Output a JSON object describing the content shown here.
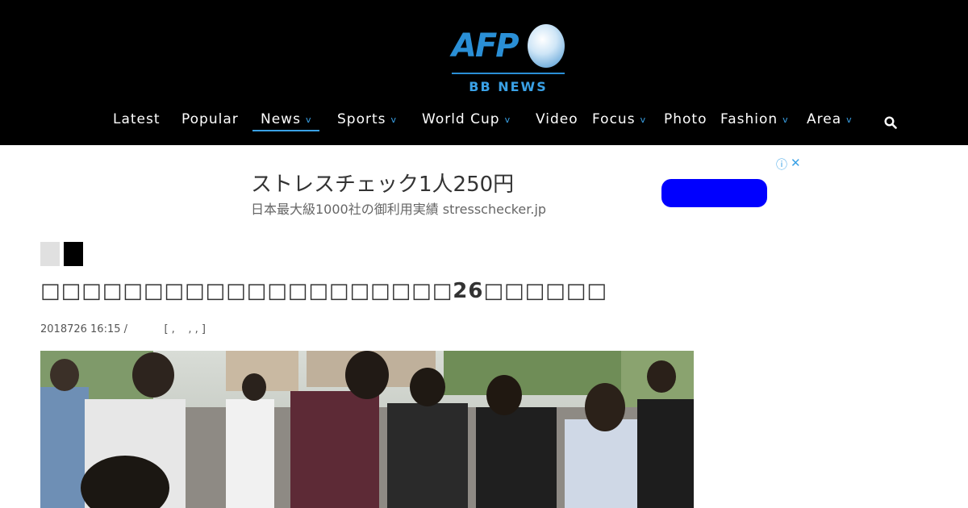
{
  "brand": {
    "logo_text": "AFP",
    "logo_subtitle": "BB NEWS"
  },
  "nav": {
    "items": [
      {
        "label": "Latest",
        "dropdown": false
      },
      {
        "label": "Popular",
        "dropdown": false
      },
      {
        "label": "News",
        "dropdown": true,
        "active": true
      },
      {
        "label": "Sports",
        "dropdown": true
      },
      {
        "label": "World Cup",
        "dropdown": true
      },
      {
        "label": "Video",
        "dropdown": false
      },
      {
        "label": "Focus",
        "dropdown": true
      },
      {
        "label": "Photo",
        "dropdown": false
      },
      {
        "label": "Fashion",
        "dropdown": true
      },
      {
        "label": "Area",
        "dropdown": true
      }
    ],
    "chevron_glyph": "v",
    "search_icon": "search-icon"
  },
  "ad": {
    "title": "ストレスチェック1人250円",
    "subtitle": "日本最大級1000社の御利用実績 stresschecker.jp",
    "info_glyph": "ⓘ",
    "close_glyph": "✕",
    "button_color": "#0000ff"
  },
  "article": {
    "headline": "□□□□□□□□□□□□□□□□□□□□26□□□□□□",
    "date": "2018726 16:15",
    "meta_rest": " /           [ ,    , , ]",
    "image_description_icon": "news-photo"
  },
  "colors": {
    "header_bg": "#000000",
    "accent": "#3aa1e6",
    "nav_text": "#ffffff"
  }
}
